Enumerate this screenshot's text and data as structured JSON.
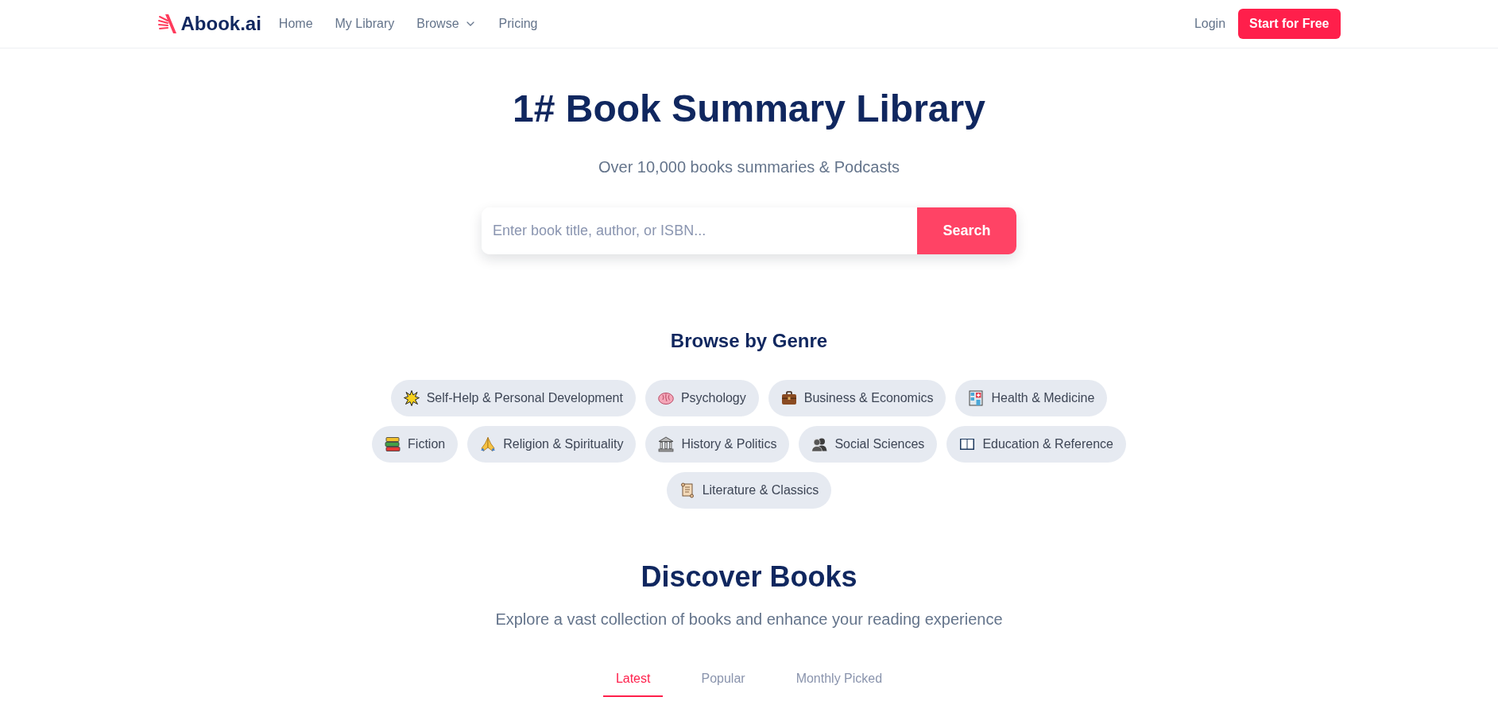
{
  "header": {
    "logo": "Abook.ai",
    "nav": [
      {
        "label": "Home",
        "kind": "link"
      },
      {
        "label": "My Library",
        "kind": "link"
      },
      {
        "label": "Browse",
        "kind": "dropdown"
      },
      {
        "label": "Pricing",
        "kind": "link"
      }
    ],
    "login": "Login",
    "cta": "Start for Free"
  },
  "hero": {
    "title": "1# Book Summary Library",
    "subtitle": "Over 10,000 books summaries & Podcasts",
    "search": {
      "placeholder": "Enter book title, author, or ISBN...",
      "button": "Search"
    }
  },
  "genres": {
    "title": "Browse by Genre",
    "items": [
      "Self-Help & Personal Development",
      "Psychology",
      "Business & Economics",
      "Health & Medicine",
      "Fiction",
      "Religion & Spirituality",
      "History & Politics",
      "Social Sciences",
      "Education & Reference",
      "Literature & Classics"
    ]
  },
  "discover": {
    "title": "Discover Books",
    "subtitle": "Explore a vast collection of books and enhance your reading experience",
    "tabs": [
      {
        "label": "Latest",
        "selected": true
      },
      {
        "label": "Popular",
        "selected": false
      },
      {
        "label": "Monthly Picked",
        "selected": false
      }
    ]
  }
}
